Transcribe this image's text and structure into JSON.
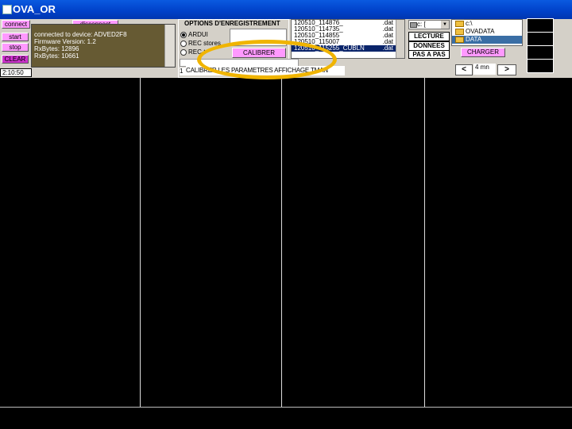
{
  "window": {
    "title": "OVA_OR"
  },
  "controls": {
    "connect": "connect",
    "disconnect": "disconnect",
    "start": "start",
    "stop": "stop",
    "clear": "CLEAR"
  },
  "status_lines": [
    "connected to device: ADVED2F8",
    "Firmware Version: 1.2",
    "RxBytes: 12896",
    "RxBytes: 10661"
  ],
  "clock": "2:10:50",
  "options": {
    "title": "OPTIONS D'ENREGISTREMENT",
    "radios": [
      "ARDUI",
      "REC stores",
      "REC-t"
    ],
    "selected_index": 0,
    "calibrate_button": "CALIBRER"
  },
  "files": [
    {
      "name": "120510_114876_",
      "ext": ".dat"
    },
    {
      "name": "120510_114735_",
      "ext": ".dat"
    },
    {
      "name": "120510_114855",
      "ext": ".dat"
    },
    {
      "name": "120510_115007",
      "ext": ".dat"
    },
    {
      "name": "120510_115255_CUBLN",
      "ext": ".dat"
    }
  ],
  "drive": {
    "label": "c: ["
  },
  "buttons": {
    "lecture": "LECTURE",
    "donnees": "DONNEES",
    "pas_a_pas": "PAS A PAS",
    "charger": "CHARGER"
  },
  "directories": [
    {
      "name": "c:\\"
    },
    {
      "name": "OVADATA"
    },
    {
      "name": "DATA"
    }
  ],
  "selected_dir_index": 2,
  "param_label": "CALIBRER LES PARAMETRES AFFICHAGE TMAN",
  "param_index": "1",
  "nav": {
    "prev": "<",
    "next": ">",
    "duration": "4 mn"
  }
}
